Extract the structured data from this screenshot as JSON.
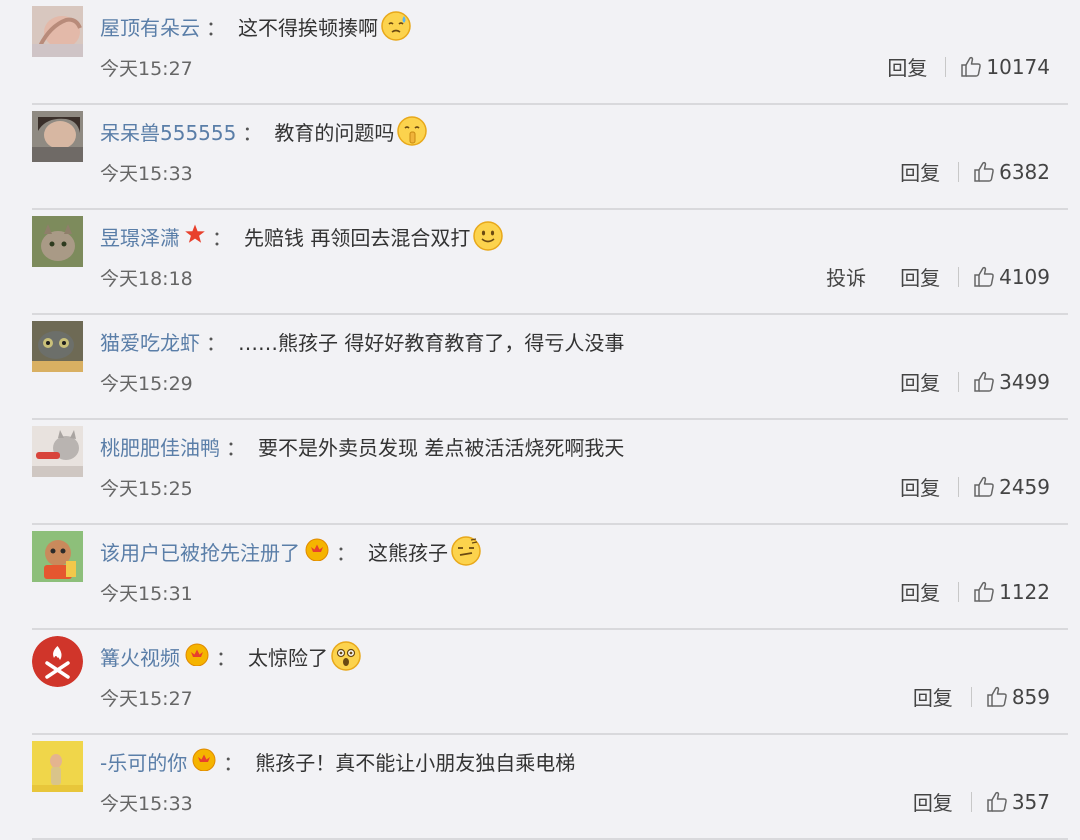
{
  "labels": {
    "reply": "回复",
    "report": "投诉",
    "colon": "："
  },
  "colors": {
    "username": "#5a7ea8",
    "background": "#f2f2f5",
    "divider": "#d9d9dc"
  },
  "comments": [
    {
      "username": "屋顶有朵云",
      "text": "这不得挨顿揍啊",
      "time": "今天15:27",
      "likes": "10174",
      "emoji": "sweat-emoji",
      "badge": "none",
      "avatar": "avatar-hand"
    },
    {
      "username": "呆呆兽555555",
      "text": "教育的问题吗",
      "time": "今天15:33",
      "likes": "6382",
      "emoji": "shush-emoji",
      "badge": "none",
      "avatar": "avatar-person"
    },
    {
      "username": "昱璟泽潇",
      "text": "先赔钱 再领回去混合双打",
      "time": "今天18:18",
      "likes": "4109",
      "emoji": "smile-emoji",
      "badge": "red-star",
      "avatar": "avatar-cat"
    },
    {
      "username": "猫爱吃龙虾",
      "text": "……熊孩子 得好好教育教育了，得亏人没事",
      "time": "今天15:29",
      "likes": "3499",
      "emoji": "none",
      "badge": "none",
      "avatar": "avatar-owl-cat"
    },
    {
      "username": "桃肥肥佳油鸭",
      "text": "要不是外卖员发现 差点被活活烧死啊我天",
      "time": "今天15:25",
      "likes": "2459",
      "emoji": "none",
      "badge": "none",
      "avatar": "avatar-kitten"
    },
    {
      "username": "该用户已被抢先注册了",
      "text": "这熊孩子",
      "time": "今天15:31",
      "likes": "1122",
      "emoji": "doh-emoji",
      "badge": "crown",
      "avatar": "avatar-cartoon"
    },
    {
      "username": "篝火视频",
      "text": "太惊险了",
      "time": "今天15:27",
      "likes": "859",
      "emoji": "shock-emoji",
      "badge": "crown",
      "avatar": "avatar-bonfire-logo"
    },
    {
      "username": "-乐可的你",
      "text": "熊孩子！真不能让小朋友独自乘电梯",
      "time": "今天15:33",
      "likes": "357",
      "emoji": "none",
      "badge": "crown",
      "avatar": "avatar-yellow"
    }
  ]
}
